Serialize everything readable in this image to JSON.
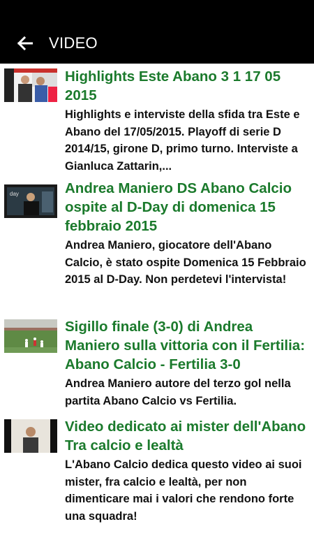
{
  "header": {
    "title": "VIDEO",
    "back_icon": "arrow-left-icon"
  },
  "colors": {
    "accent_green": "#1b7a2c",
    "bar": "#000000"
  },
  "videos": [
    {
      "title": "Highlights Este Abano 3 1 17 05 2015",
      "description": "Highlights e interviste della sfida tra Este e Abano del 17/05/2015. Playoff di serie D 2014/15, girone D, primo turno. Interviste a Gianluca Zattarin,..."
    },
    {
      "title": "Andrea Maniero DS Abano Calcio ospite al D-Day di domenica 15 febbraio 2015",
      "description": "Andrea Maniero, giocatore dell'Abano Calcio, è stato ospite Domenica 15 Febbraio 2015 al D-Day. Non perdetevi l'intervista!"
    },
    {
      "title": "Sigillo finale (3-0) di Andrea Maniero sulla vittoria con il Fertilia: Abano Calcio - Fertilia 3-0",
      "description": "Andrea Maniero autore del terzo gol nella partita Abano Calcio vs Fertilia."
    },
    {
      "title": "Video dedicato ai mister dell'Abano Tra calcio e lealtà",
      "description": "L'Abano Calcio dedica questo video ai suoi mister, fra calcio e lealtà, per non dimenticare mai i valori che rendono forte una squadra!"
    }
  ]
}
